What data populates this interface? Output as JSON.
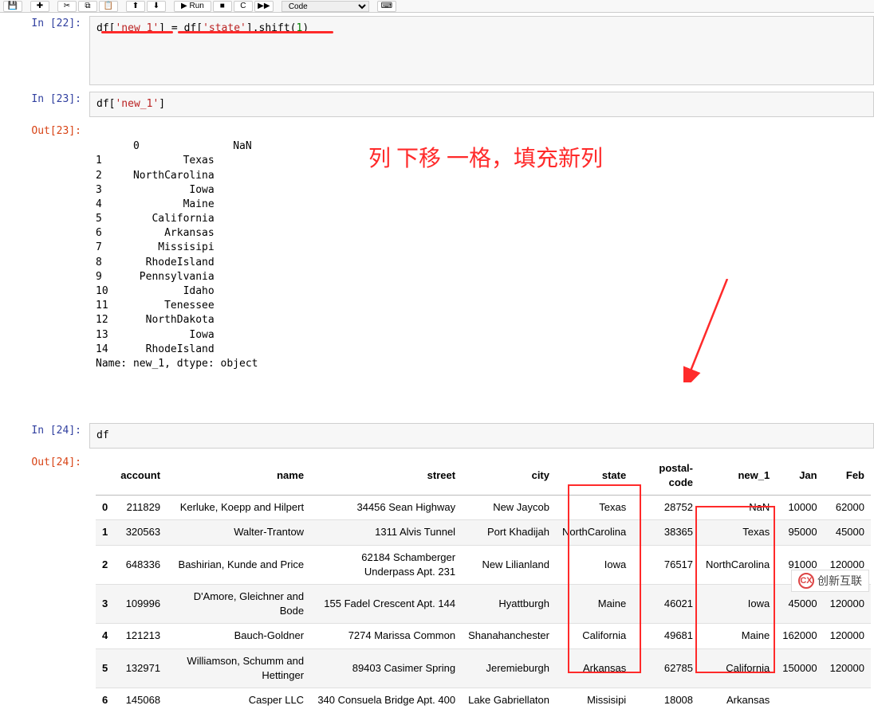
{
  "toolbar": {
    "save": "💾",
    "add": "✚",
    "cut": "✂",
    "copy": "⧉",
    "paste": "📋",
    "up": "⬆",
    "down": "⬇",
    "run": "▶ Run",
    "stop": "■",
    "restart": "C",
    "restart_run": "▶▶",
    "cell_type": "Code",
    "cmd": "⌨"
  },
  "cells": {
    "c22_prompt": "In [22]:",
    "c22_p1": "df[",
    "c22_s1": "'new_1'",
    "c22_p2": "] = df[",
    "c22_s2": "'state'",
    "c22_p3": "].shift(",
    "c22_n1": "1",
    "c22_p4": ")",
    "c23_prompt": "In [23]:",
    "c23_p1": "df[",
    "c23_s1": "'new_1'",
    "c23_p2": "]",
    "out23_prompt": "Out[23]:",
    "out23_text": "0               NaN\n1             Texas\n2     NorthCarolina\n3              Iowa\n4             Maine\n5        California\n6          Arkansas\n7         Missisipi\n8       RhodeIsland\n9      Pennsylvania\n10            Idaho\n11         Tenessee\n12      NorthDakota\n13             Iowa\n14      RhodeIsland\nName: new_1, dtype: object",
    "c24_prompt": "In [24]:",
    "c24_code": "df",
    "out24_prompt": "Out[24]:"
  },
  "annotation": "列 下移 一格，填充新列",
  "dataframe": {
    "columns": [
      "",
      "account",
      "name",
      "street",
      "city",
      "state",
      "postal-code",
      "new_1",
      "Jan",
      "Feb"
    ],
    "rows": [
      {
        "idx": "0",
        "account": "211829",
        "name": "Kerluke, Koepp and Hilpert",
        "street": "34456 Sean Highway",
        "city": "New Jaycob",
        "state": "Texas",
        "postal": "28752",
        "new1": "NaN",
        "jan": "10000",
        "feb": "62000"
      },
      {
        "idx": "1",
        "account": "320563",
        "name": "Walter-Trantow",
        "street": "1311 Alvis Tunnel",
        "city": "Port Khadijah",
        "state": "NorthCarolina",
        "postal": "38365",
        "new1": "Texas",
        "jan": "95000",
        "feb": "45000"
      },
      {
        "idx": "2",
        "account": "648336",
        "name": "Bashirian, Kunde and Price",
        "street": "62184 Schamberger Underpass Apt. 231",
        "city": "New Lilianland",
        "state": "Iowa",
        "postal": "76517",
        "new1": "NorthCarolina",
        "jan": "91000",
        "feb": "120000"
      },
      {
        "idx": "3",
        "account": "109996",
        "name": "D'Amore, Gleichner and Bode",
        "street": "155 Fadel Crescent Apt. 144",
        "city": "Hyattburgh",
        "state": "Maine",
        "postal": "46021",
        "new1": "Iowa",
        "jan": "45000",
        "feb": "120000"
      },
      {
        "idx": "4",
        "account": "121213",
        "name": "Bauch-Goldner",
        "street": "7274 Marissa Common",
        "city": "Shanahanchester",
        "state": "California",
        "postal": "49681",
        "new1": "Maine",
        "jan": "162000",
        "feb": "120000"
      },
      {
        "idx": "5",
        "account": "132971",
        "name": "Williamson, Schumm and Hettinger",
        "street": "89403 Casimer Spring",
        "city": "Jeremieburgh",
        "state": "Arkansas",
        "postal": "62785",
        "new1": "California",
        "jan": "150000",
        "feb": "120000"
      },
      {
        "idx": "6",
        "account": "145068",
        "name": "Casper LLC",
        "street": "340 Consuela Bridge Apt. 400",
        "city": "Lake Gabriellaton",
        "state": "Missisipi",
        "postal": "18008",
        "new1": "Arkansas",
        "jan": "",
        "feb": ""
      }
    ]
  },
  "watermark": "创新互联"
}
